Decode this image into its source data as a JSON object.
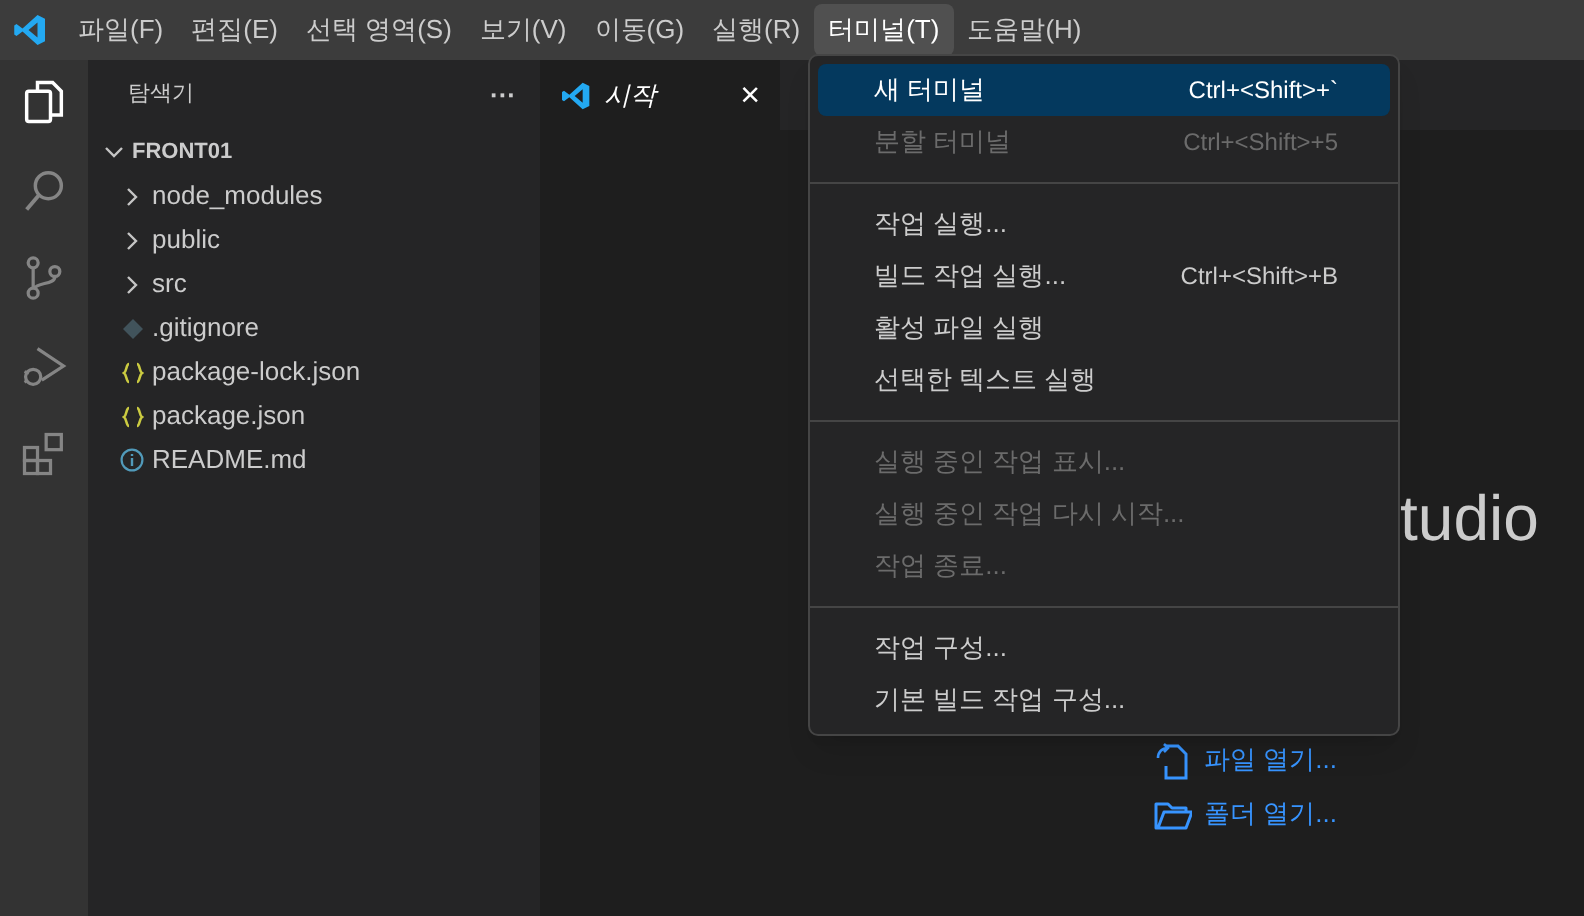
{
  "menubar": [
    {
      "label": "파일(F)",
      "selected": false
    },
    {
      "label": "편집(E)",
      "selected": false
    },
    {
      "label": "선택 영역(S)",
      "selected": false
    },
    {
      "label": "보기(V)",
      "selected": false
    },
    {
      "label": "이동(G)",
      "selected": false
    },
    {
      "label": "실행(R)",
      "selected": false
    },
    {
      "label": "터미널(T)",
      "selected": true
    },
    {
      "label": "도움말(H)",
      "selected": false
    }
  ],
  "activity_bar": [
    {
      "kind": "files",
      "selected": true
    },
    {
      "kind": "search",
      "selected": false
    },
    {
      "kind": "source-control",
      "selected": false
    },
    {
      "kind": "run",
      "selected": false
    },
    {
      "kind": "extensions",
      "selected": false
    }
  ],
  "sidebar": {
    "title": "탐색기",
    "more": "···",
    "root": {
      "label": "FRONT01",
      "expanded": true,
      "children": [
        {
          "label": "node_modules",
          "kind": "folder",
          "expanded": false
        },
        {
          "label": "public",
          "kind": "folder",
          "expanded": false
        },
        {
          "label": "src",
          "kind": "folder",
          "expanded": false
        },
        {
          "label": ".gitignore",
          "kind": "git"
        },
        {
          "label": "package-lock.json",
          "kind": "json"
        },
        {
          "label": "package.json",
          "kind": "json"
        },
        {
          "label": "README.md",
          "kind": "info"
        }
      ]
    }
  },
  "tabs": [
    {
      "label": "시작",
      "selected": true,
      "close": "×"
    }
  ],
  "editor": {
    "heading": "tudio",
    "links": [
      {
        "label": "파일 열기...",
        "kind": "open-file"
      },
      {
        "label": "폴더 열기...",
        "kind": "open-folder"
      }
    ]
  },
  "menu": {
    "groups": [
      [
        {
          "label": "새 터미널",
          "shortcut": "Ctrl+<Shift>+`",
          "disabled": false,
          "selected": true
        },
        {
          "label": "분할 터미널",
          "shortcut": "Ctrl+<Shift>+5",
          "disabled": true,
          "selected": false
        }
      ],
      [
        {
          "label": "작업 실행...",
          "disabled": false,
          "selected": false
        },
        {
          "label": "빌드 작업 실행...",
          "shortcut": "Ctrl+<Shift>+B",
          "disabled": false,
          "selected": false
        },
        {
          "label": "활성 파일 실행",
          "disabled": false,
          "selected": false
        },
        {
          "label": "선택한 텍스트 실행",
          "disabled": false,
          "selected": false
        }
      ],
      [
        {
          "label": "실행 중인 작업 표시...",
          "disabled": true,
          "selected": false
        },
        {
          "label": "실행 중인 작업 다시 시작...",
          "disabled": true,
          "selected": false
        },
        {
          "label": "작업 종료...",
          "disabled": true,
          "selected": false
        }
      ],
      [
        {
          "label": "작업 구성...",
          "disabled": false,
          "selected": false
        },
        {
          "label": "기본 빌드 작업 구성...",
          "disabled": false,
          "selected": false
        }
      ]
    ]
  }
}
